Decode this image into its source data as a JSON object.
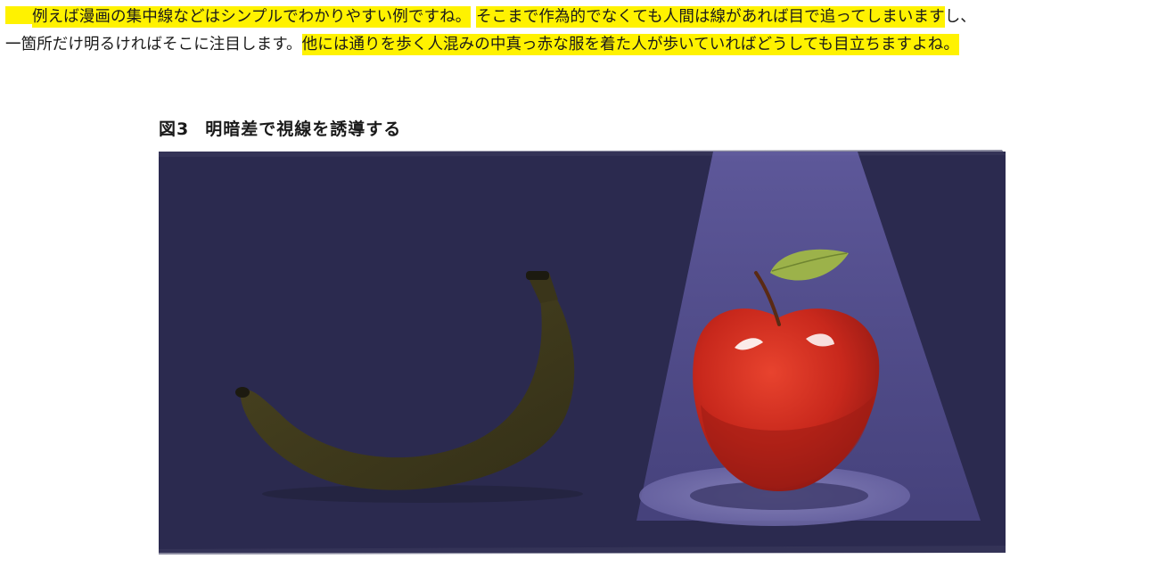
{
  "paragraph": {
    "line1": {
      "s1": "例えば漫画の集中線などはシンプルでわかりやすい例ですね。",
      "s2": "そこまで作為的でなくても人間は線があれば目で追ってしまいます",
      "s3": "し、"
    },
    "line2": {
      "s1": "一箇所だけ明るければそこに注目します。",
      "s2": "他には通りを歩く人混みの中真っ赤な服を着た人が歩いていればどうしても目立ちますよね。"
    }
  },
  "figure": {
    "number": "図3",
    "title": "明暗差で視線を誘導する"
  },
  "colors": {
    "highlight": "#fff200",
    "background": "#2b2a4f",
    "spotlight": "#6a63b5",
    "apple": "#c8281c",
    "banana": "#3f3a1c",
    "leaf": "#9cb24a"
  },
  "illustration": {
    "subjects": [
      "banana-icon",
      "apple-icon",
      "spotlight-icon"
    ]
  }
}
